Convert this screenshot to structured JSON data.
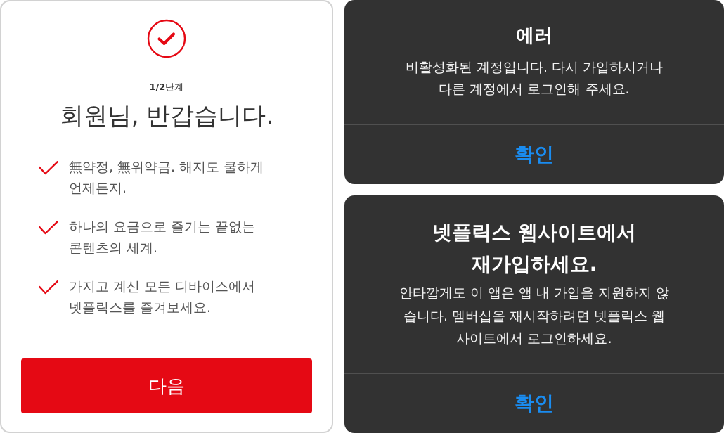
{
  "signup_card": {
    "step": "**1/2**단계",
    "title": "회원님, 반갑습니다.",
    "benefits": [
      {
        "text": "無약정, 無위약금. 해지도 쿨하게\n언제든지."
      },
      {
        "text": "하나의 요금으로 즐기는 끝없는\n콘텐츠의 세계."
      },
      {
        "text": "가지고 계신 모든 디바이스에서\n넷플릭스를 즐겨보세요."
      }
    ],
    "next_button": "다음"
  },
  "dialogs": [
    {
      "title": "에러",
      "message": "비활성화된 계정입니다. 다시 가입하시거나\n다른 계정에서 로그인해 주세요.",
      "button": "확인"
    },
    {
      "title": "넷플릭스 웹사이트에서\n재가입하세요.",
      "message": "안타깝게도 이 앱은 앱 내 가입을 지원하지 않\n습니다. 멤버십을 재시작하려면 넷플릭스 웹\n사이트에서 로그인하세요.",
      "button": "확인"
    }
  ]
}
